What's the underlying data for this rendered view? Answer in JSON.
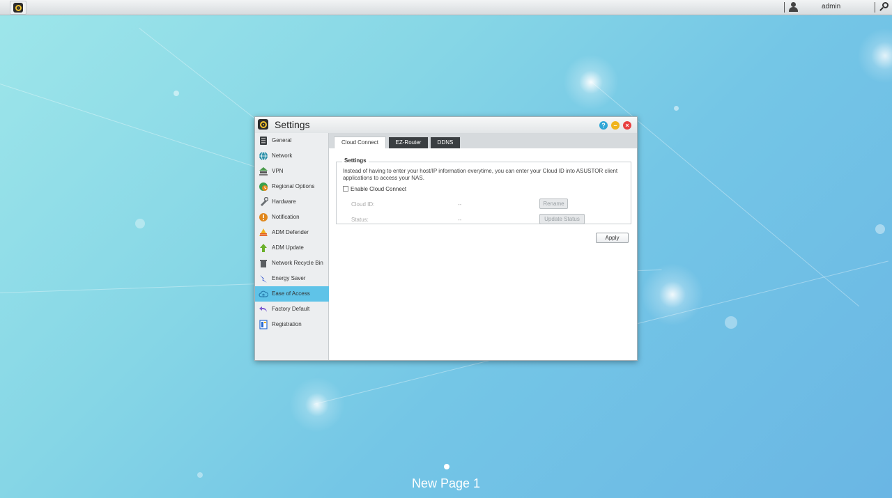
{
  "taskbar": {
    "app_icon": "settings-gear-icon",
    "user_icon": "user-icon",
    "username": "admin",
    "search_icon": "search-icon"
  },
  "window": {
    "title": "Settings",
    "buttons": {
      "help": "?",
      "minimize": "–",
      "close": "×"
    }
  },
  "sidebar": {
    "items": [
      {
        "label": "General",
        "icon": "general-icon",
        "color": "#3a3e41"
      },
      {
        "label": "Network",
        "icon": "globe-icon",
        "color": "#2a8fa8"
      },
      {
        "label": "VPN",
        "icon": "vpn-icon",
        "color": "#4a9a4a"
      },
      {
        "label": "Regional Options",
        "icon": "regional-icon",
        "color": "#3aa04a"
      },
      {
        "label": "Hardware",
        "icon": "hardware-icon",
        "color": "#6a6f73"
      },
      {
        "label": "Notification",
        "icon": "notification-icon",
        "color": "#e0871c"
      },
      {
        "label": "ADM Defender",
        "icon": "defender-icon",
        "color": "#e05a1c"
      },
      {
        "label": "ADM Update",
        "icon": "update-icon",
        "color": "#6ab02a"
      },
      {
        "label": "Network Recycle Bin",
        "icon": "recycle-bin-icon",
        "color": "#5a5e61"
      },
      {
        "label": "Energy Saver",
        "icon": "energy-saver-icon",
        "color": "#3a5ad0"
      },
      {
        "label": "Ease of Access",
        "icon": "cloud-icon",
        "color": "#2a7fb0"
      },
      {
        "label": "Factory Default",
        "icon": "undo-icon",
        "color": "#7a5ad0"
      },
      {
        "label": "Registration",
        "icon": "registration-icon",
        "color": "#2a6ad0"
      }
    ],
    "active_index": 10
  },
  "tabs": {
    "cloud_connect": "Cloud Connect",
    "ez_router": "EZ-Router",
    "ddns": "DDNS"
  },
  "settings": {
    "legend": "Settings",
    "description": "Instead of having to enter your host/IP information everytime, you can enter your Cloud ID into ASUSTOR client applications to access your NAS.",
    "enable_label": "Enable Cloud Connect",
    "enable_checked": false,
    "cloud_id_label": "Cloud ID:",
    "cloud_id_value": "--",
    "status_label": "Status:",
    "status_value": "--",
    "rename_button": "Rename",
    "update_status_button": "Update Status"
  },
  "apply_button": "Apply",
  "desktop": {
    "page_label": "New Page 1"
  }
}
